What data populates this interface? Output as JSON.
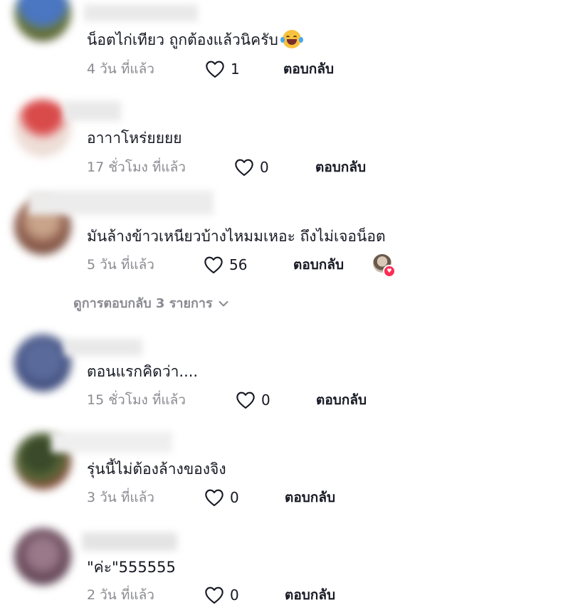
{
  "comments": [
    {
      "text": "น็อตไก่เทียว ถูกต้องแล้วนิครับ",
      "emoji": "rolling-on-floor-laughing-emoji",
      "time": "4 วัน ที่แล้ว",
      "likes": "1",
      "reply_label": "ตอบกลับ",
      "avatar_colors": [
        "#4a76c2",
        "#6b7a3a"
      ]
    },
    {
      "text": "อาาาโหร่ยยยย",
      "time": "17 ชั่วโมง ที่แล้ว",
      "likes": "0",
      "reply_label": "ตอบกลับ",
      "avatar_colors": [
        "#d94a4a",
        "#f0e6e0"
      ]
    },
    {
      "text": "มันล้างข้าวเหนียวบ้างไหมมเหอะ ถึงไม่เจอน็อต",
      "time": "5 วัน ที่แล้ว",
      "likes": "56",
      "reply_label": "ตอบกลับ",
      "avatar_colors": [
        "#8a5a4a",
        "#c9a38a"
      ]
    },
    {
      "text": "ตอนแรกคิดว่า....",
      "time": "15 ชั่วโมง ที่แล้ว",
      "likes": "0",
      "reply_label": "ตอบกลับ",
      "avatar_colors": [
        "#3c4a7a",
        "#5a6a9a"
      ]
    },
    {
      "text": "รุ่นนี้ไม่ต้องล้างของจิง",
      "time": "3 วัน ที่แล้ว",
      "likes": "0",
      "reply_label": "ตอบกลับ",
      "avatar_colors": [
        "#5a6a3a",
        "#8a4a3a"
      ]
    },
    {
      "text": "\"ค่ะ\"555555",
      "time": "2 วัน ที่แล้ว",
      "likes": "0",
      "reply_label": "ตอบกลับ",
      "avatar_colors": [
        "#6a4a5a",
        "#9a7a8a"
      ]
    }
  ],
  "view_replies": {
    "label": "ดูการตอบกลับ 3 รายการ",
    "icon": "chevron-down-icon"
  },
  "colors": {
    "text": "#161823",
    "secondary": "#8a8b91",
    "heart_badge": "#fe2c55"
  }
}
